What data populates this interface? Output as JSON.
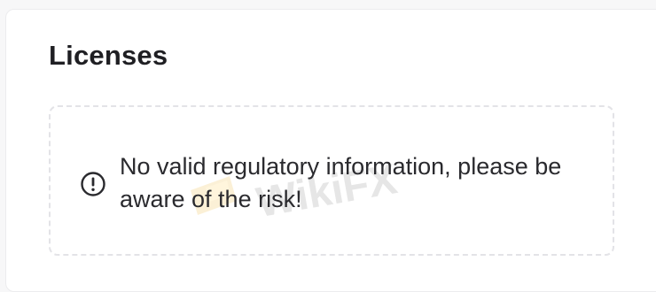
{
  "licenses": {
    "title": "Licenses",
    "notice_text": "No valid regulatory information, please be aware of the risk!",
    "notice_icon": "exclamation-circle-icon",
    "watermark_text": "WikiFX"
  },
  "colors": {
    "card_background": "#ffffff",
    "page_background": "#f7f7f8",
    "title": "#1f1f23",
    "text": "#2a2a2e",
    "dashed_border": "#e3e3e7",
    "watermark": "#f2e7c8"
  }
}
